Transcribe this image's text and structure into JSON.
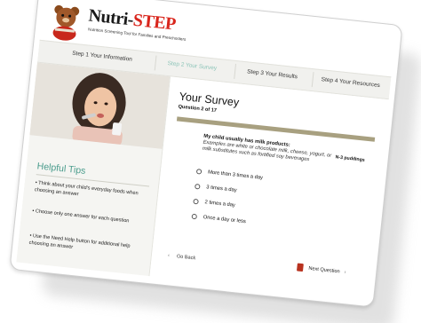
{
  "header": {
    "logo_nutri": "Nutri",
    "logo_dash": "-",
    "logo_step": "STEP",
    "tagline": "Nutrition Screening Tool for Families and Preschoolers"
  },
  "steps": [
    {
      "label": "Step 1 Your Information",
      "active": false
    },
    {
      "label": "Step 2 Your Survey",
      "active": true
    },
    {
      "label": "Step 3 Your Results",
      "active": false
    },
    {
      "label": "Step 4 Your Resources",
      "active": false
    }
  ],
  "tips": {
    "title": "Helpful Tips",
    "items": [
      "• Think about your child's everyday foods when choosing an answer",
      "• Choose only one answer for each question",
      "• Use the Need Help button for additional help choosing an answer"
    ]
  },
  "survey": {
    "title": "Your Survey",
    "question_number": "Question 2 of 17",
    "question": "My child usually has milk products:",
    "hint": "Examples are white or chocolate milk, cheese, yogurt, or milk substitutes such as fortified soy beverages",
    "hint_extra": "N-3 puddings",
    "options": [
      "More than 3 times a day",
      "3 times a day",
      "2 times a day",
      "Once a day or less"
    ],
    "back_label": "Go Back",
    "next_label": "Next Question"
  },
  "colors": {
    "accent_teal": "#4a9c8c",
    "brand_red": "#d9251c",
    "divider_bar": "#a8a080"
  }
}
